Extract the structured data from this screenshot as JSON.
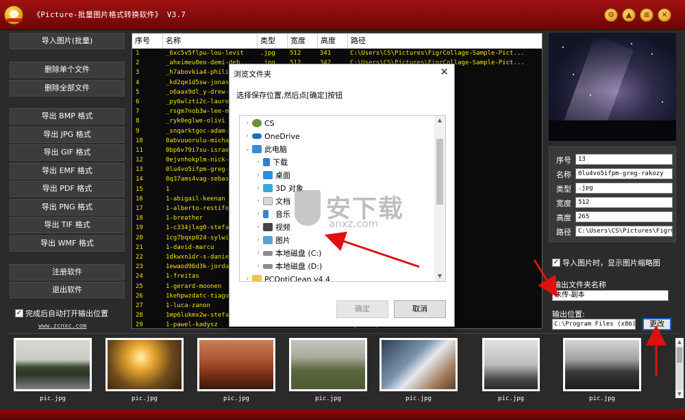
{
  "window": {
    "title": "《Picture-批量图片格式转换软件》 V3.7",
    "controls": [
      "settings-icon",
      "skin-icon",
      "minimize-icon",
      "close-icon"
    ]
  },
  "sidebar": {
    "import_label": "导入图片(批量)",
    "delete_single_label": "删除单个文件",
    "delete_all_label": "删除全部文件",
    "export_labels": [
      "导出 BMP 格式",
      "导出 JPG 格式",
      "导出 GIF 格式",
      "导出 EMF 格式",
      "导出 PDF 格式",
      "导出 PNG 格式",
      "导出 TIF 格式",
      "导出 WMF 格式"
    ],
    "register_label": "注册软件",
    "exit_label": "退出软件",
    "auto_open_label": "完成后自动打开输出位置",
    "auto_open_checked": true,
    "website": "www.zcnxc.com"
  },
  "table": {
    "headers": [
      "序号",
      "名称",
      "类型",
      "宽度",
      "高度",
      "路径"
    ],
    "rows": [
      [
        "1",
        "_6xc5v5flpu-lou-levit",
        ".jpg",
        "512",
        "341",
        "C:\\Users\\CS\\Pictures\\FigrCollage-Sample-Pict..."
      ],
      [
        "2",
        "_ahximeu0eo-demi-deh...",
        ".jpg",
        "512",
        "342",
        "C:\\Users\\CS\\Pictures\\FigrCollage-Sample-Pict..."
      ],
      [
        "3",
        "_h7abovkia4-philip",
        "",
        "",
        "",
        "age-Sample-Pict..."
      ],
      [
        "4",
        "_kd2qe1d5sw-jonast",
        "",
        "",
        "",
        "age-Sample-Pict..."
      ],
      [
        "5",
        "_o6aax9dl_y-drew-g",
        "",
        "",
        "",
        "age-Sample-Pict..."
      ],
      [
        "6",
        "_py6wlzti2c-laure",
        "",
        "",
        "",
        "age-Sample-Pict..."
      ],
      [
        "7",
        "_rsgm7nob3w-lee-m",
        "",
        "",
        "",
        "age-Sample-Pict..."
      ],
      [
        "8",
        "_ryk0eglwe-olivi",
        "",
        "",
        "",
        "age-Sample-Pict..."
      ],
      [
        "9",
        "_snqarktgoc-adam-",
        "",
        "",
        "",
        "age-Sample-Pict..."
      ],
      [
        "10",
        "0abvuuorulu-micha",
        "",
        "",
        "",
        "age-Sample-Pict..."
      ],
      [
        "11",
        "0bp6v79i7su-israe",
        "",
        "",
        "",
        "age-Sample-Pict..."
      ],
      [
        "12",
        "0ejvnhokplm-nick-",
        "",
        "",
        "",
        "age-Sample-Pict..."
      ],
      [
        "13",
        "0lu4vo5ifpm-greg-",
        "",
        "",
        "",
        "age-Sample-Pict..."
      ],
      [
        "14",
        "0q37ams4vag-sebas",
        "",
        "",
        "",
        "age-Sample-Pict..."
      ],
      [
        "15",
        "1",
        "",
        "",
        "",
        "age-Sample-Pict..."
      ],
      [
        "16",
        "1-abigail-keenan",
        "",
        "",
        "",
        "age-Sample-Pict..."
      ],
      [
        "17",
        "1-alberto-restifo",
        "",
        "",
        "",
        "age-Sample-Pict..."
      ],
      [
        "18",
        "1-breather",
        "",
        "",
        "",
        "age-Sample-Pict..."
      ],
      [
        "19",
        "1-c334jlxg0-stefa",
        "",
        "",
        "",
        "age-Sample-Pict..."
      ],
      [
        "20",
        "1cg7bqxp024-sylwi",
        "",
        "",
        "",
        "age-Sample-Pict..."
      ],
      [
        "21",
        "1-david-marcu",
        "",
        "",
        "",
        "age-Sample-Pict..."
      ],
      [
        "22",
        "1dkwxn1dr-s-danie",
        "",
        "",
        "",
        "age-Sample-Pict..."
      ],
      [
        "23",
        "1ewaod96d3k-jorda",
        "",
        "",
        "",
        "age-Sample-Pict..."
      ],
      [
        "24",
        "1-freitas",
        "",
        "",
        "",
        "age-Sample-Pict..."
      ],
      [
        "25",
        "1-gerard-moonen",
        "",
        "",
        "",
        "age-Sample-Pict..."
      ],
      [
        "26",
        "1kehpwzdatc-tiago",
        "",
        "",
        "",
        "age-Sample-Pict..."
      ],
      [
        "27",
        "1-luca-zanon",
        "",
        "",
        "",
        "age-Sample-Pict..."
      ],
      [
        "28",
        "1mp6lukmx2w-stefa",
        "",
        "",
        "",
        "age-Sample-Pict..."
      ],
      [
        "29",
        "1-pawel-kadysz",
        "",
        "",
        "",
        "age-Sample-Pict..."
      ]
    ]
  },
  "info": {
    "seq_label": "序号",
    "seq_value": "13",
    "name_label": "名称",
    "name_value": "0lu4vo5ifpm-greg-rakozy",
    "type_label": "类型",
    "type_value": ".jpg",
    "width_label": "宽度",
    "width_value": "512",
    "height_label": "高度",
    "height_value": "265",
    "path_label": "路径",
    "path_value": "C:\\Users\\CS\\Pictures\\FigrC"
  },
  "output": {
    "show_thumb_label": "导入图片时，显示图片缩略图",
    "show_thumb_checked": true,
    "folder_name_label": "输出文件夹名称",
    "folder_name_value": "未传-副本",
    "location_label": "输出位置:",
    "location_value": "C:\\Program Files (x86)",
    "change_label": "更改"
  },
  "thumbnails": [
    {
      "label": "pic.jpg"
    },
    {
      "label": "pic.jpg"
    },
    {
      "label": "pic.jpg"
    },
    {
      "label": "pic.jpg"
    },
    {
      "label": "pic.jpg"
    },
    {
      "label": "pic.jpg"
    },
    {
      "label": "pic.jpg"
    }
  ],
  "dialog": {
    "title": "浏览文件夹",
    "instruction": "选择保存位置,然后点[确定]按钮",
    "tree": [
      {
        "label": "CS",
        "icon": "user-folder-icon"
      },
      {
        "label": "OneDrive",
        "icon": "cloud-icon"
      },
      {
        "label": "此电脑",
        "icon": "computer-icon"
      },
      {
        "label": "下载",
        "icon": "download-icon"
      },
      {
        "label": "桌面",
        "icon": "desktop-icon"
      },
      {
        "label": "3D 对象",
        "icon": "3d-objects-icon"
      },
      {
        "label": "文档",
        "icon": "document-icon"
      },
      {
        "label": "音乐",
        "icon": "music-icon"
      },
      {
        "label": "视频",
        "icon": "video-icon"
      },
      {
        "label": "图片",
        "icon": "picture-icon"
      },
      {
        "label": "本地磁盘 (C:)",
        "icon": "drive-icon"
      },
      {
        "label": "本地磁盘 (D:)",
        "icon": "drive-icon"
      },
      {
        "label": "PCOptiClean v4.4",
        "icon": "folder-icon"
      }
    ],
    "ok_label": "确定",
    "cancel_label": "取消"
  },
  "watermark": {
    "big": "安下载",
    "small": "anxz.com"
  },
  "colors": {
    "title_bar": "#8b0b0b",
    "table_text": "#f4e300",
    "accent_arrow": "#e01010",
    "button_focus": "#1e5fd6"
  }
}
